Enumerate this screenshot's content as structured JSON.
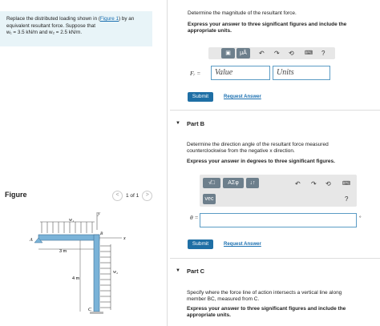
{
  "problem": {
    "text1": "Replace the distributed loading shown in (",
    "link": "Figure 1",
    "text2": ") by an",
    "line2": "equivalent resultant force. Suppose that",
    "line3": "w₁ = 3.5 kN/m and w₂ = 2.5 kN/m."
  },
  "figure": {
    "title": "Figure",
    "pager": "1 of 1",
    "prev": "<",
    "next": ">",
    "labels": {
      "w1": "w₁",
      "w2": "w₂",
      "y": "y",
      "x": "x",
      "A": "A",
      "B": "B",
      "C": "C",
      "d3": "3 m",
      "d4": "4 m"
    }
  },
  "partA": {
    "prompt": "Determine the magnitude of the resultant force.",
    "instruction": "Express your answer to three significant figures and include the appropriate units.",
    "toolbar": {
      "mu": "μÅ",
      "help": "?"
    },
    "label": "Fᵣ =",
    "value_placeholder": "Value",
    "units_placeholder": "Units",
    "submit": "Submit",
    "request": "Request Answer"
  },
  "partB": {
    "title": "Part B",
    "prompt1": "Determine the direction angle of the resultant force measured",
    "prompt2": "counterclockwise from the negative x direction.",
    "instruction": "Express your answer in degrees to three significant figures.",
    "toolbar": {
      "sqrt": "√□",
      "greek": "AΣφ",
      "arrows": "↓↑",
      "vec": "vec",
      "help": "?"
    },
    "label": "θ =",
    "unit": "°",
    "submit": "Submit",
    "request": "Request Answer"
  },
  "partC": {
    "title": "Part C",
    "prompt1": "Specify where the force line of action intersects a vertical line along",
    "prompt2": "member BC, measured from C.",
    "instruction": "Express your answer to three significant figures and include the appropriate units."
  }
}
